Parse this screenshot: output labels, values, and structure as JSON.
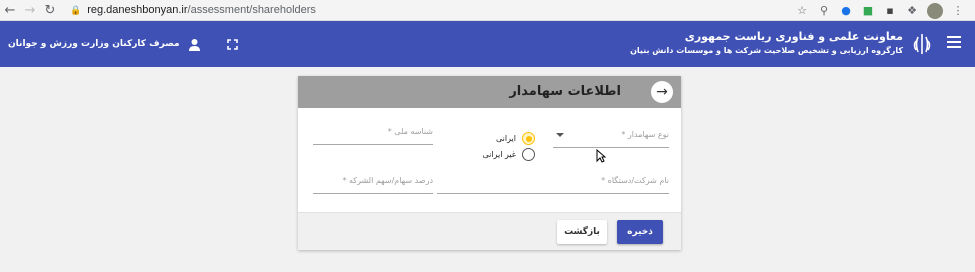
{
  "browser": {
    "url_domain": "reg.daneshbonyan.ir",
    "url_path": "/assessment/shareholders"
  },
  "appbar": {
    "title": "معاونت علمی و فناوری ریاست جمهوری",
    "subtitle": "کارگروه ارزیابی و تشخیص صلاحیت شرکت ها و موسسات دانش بنیان",
    "user_name": "مصرف کارکنان وزارت ورزش و جوانان"
  },
  "form": {
    "title": "اطلاعات سهامدار",
    "shareholder_type_label": "نوع سهامدار *",
    "national_id_label": "شناسه ملی *",
    "company_name_label": "نام شرکت/دستگاه *",
    "share_percent_label": "درصد سهام/سهم الشرکه *",
    "radio_iranian": "ایرانی",
    "radio_non_iranian": "غیر ایرانی",
    "selected_radio": "iranian",
    "save_label": "ذخیره",
    "back_label": "بازگشت"
  },
  "colors": {
    "primary": "#3f51b5",
    "header_gray": "#9e9e9e",
    "radio_accent": "#ffc107"
  }
}
